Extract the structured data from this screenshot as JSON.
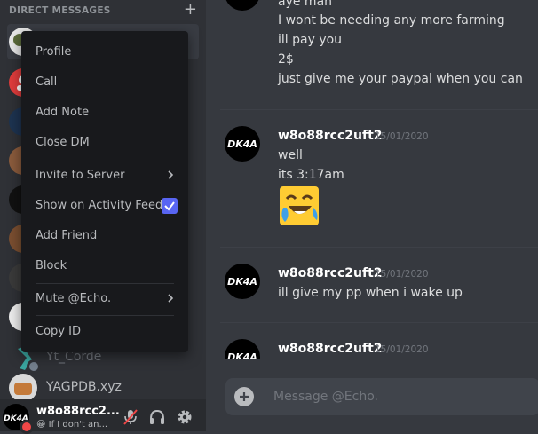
{
  "sidebar": {
    "header": {
      "label": "DIRECT MESSAGES",
      "add_icon": "plus-icon"
    },
    "partial_items": [
      {
        "name": "Yt_Corde"
      },
      {
        "name": "YAGPDB.xyz"
      }
    ]
  },
  "context_menu": {
    "items": [
      {
        "label": "Profile"
      },
      {
        "label": "Call"
      },
      {
        "label": "Add Note"
      },
      {
        "label": "Close DM"
      },
      {
        "label": "Invite to Server",
        "submenu": true
      },
      {
        "label": "Show on Activity Feed",
        "checked": true
      },
      {
        "label": "Add Friend"
      },
      {
        "label": "Block"
      },
      {
        "label": "Mute @Echo.",
        "submenu": true
      },
      {
        "label": "Copy ID"
      }
    ]
  },
  "user_panel": {
    "name": "w8o88rcc2...",
    "status": "If I don't an..."
  },
  "chat": {
    "top_lines": [
      "aye man",
      "I wont be needing any more farming",
      "ill pay you",
      "2$",
      "just give me your paypal when you can"
    ],
    "groups": [
      {
        "author": "w8o88rcc2uft2",
        "timestamp": "15/01/2020",
        "lines": [
          "well",
          "its 3:17am"
        ],
        "emoji": "laughing-tears-emoji"
      },
      {
        "author": "w8o88rcc2uft2",
        "timestamp": "15/01/2020",
        "lines": [
          "ill give my pp when i wake up"
        ]
      },
      {
        "author": "w8o88rcc2uft2",
        "timestamp": "15/01/2020",
        "lines": []
      }
    ],
    "avatar_text": "DK4A",
    "composer_placeholder": "Message @Echo."
  },
  "colors": {
    "background": "#36393f",
    "sidebar": "#2f3136",
    "menu": "#18191c",
    "accent": "#5865f2",
    "status_online": "#43b581",
    "status_dnd": "#f04747"
  }
}
